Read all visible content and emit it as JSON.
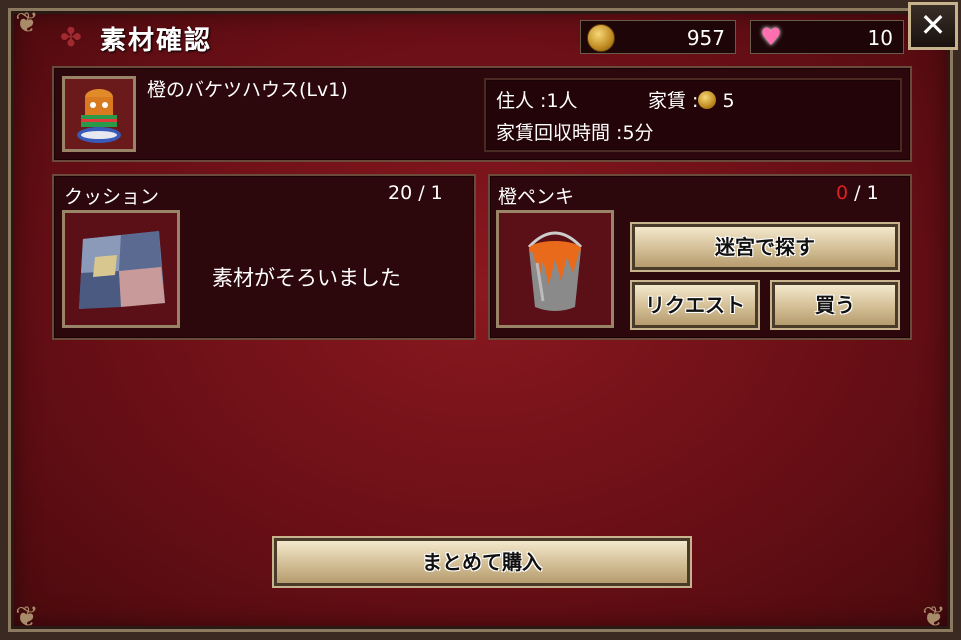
{
  "header": {
    "title": "素材確認"
  },
  "currency": {
    "coins": "957",
    "gems": "10"
  },
  "close_label": "✕",
  "house": {
    "name": "橙のバケツハウス(Lv1)",
    "residents_label": "住人 :1人",
    "rent_label": "家賃 :",
    "rent_value": "5",
    "collect_label": "家賃回収時間 :5分"
  },
  "materials": [
    {
      "name": "クッション",
      "have": "20",
      "need": "1",
      "status": "素材がそろいました"
    },
    {
      "name": "橙ペンキ",
      "have": "0",
      "need": "1",
      "have_color": "#e02020"
    }
  ],
  "buttons": {
    "search": "迷宮で探す",
    "request": "リクエスト",
    "buy": "買う",
    "bulk_buy": "まとめて購入"
  },
  "icons": {
    "coin": "coin-icon",
    "gem": "heart-gem-icon",
    "close": "close-icon"
  }
}
